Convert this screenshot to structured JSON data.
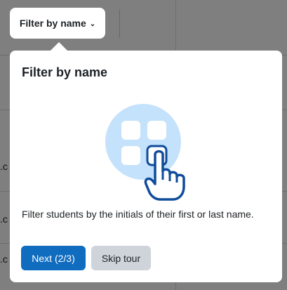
{
  "background": {
    "row_fragments": [
      ".c",
      ".c",
      ".c"
    ]
  },
  "filter_button": {
    "label": "Filter by name"
  },
  "tour": {
    "title": "Filter by name",
    "description": "Filter students by the initials of their first or last name.",
    "next_label": "Next (2/3)",
    "skip_label": "Skip tour",
    "illustration_icon": "tap-grid-icon"
  },
  "colors": {
    "primary": "#0f6cbf",
    "secondary": "#ced4da",
    "illustration_circle": "#c4e2fb",
    "illustration_stroke": "#0f4c9b"
  }
}
